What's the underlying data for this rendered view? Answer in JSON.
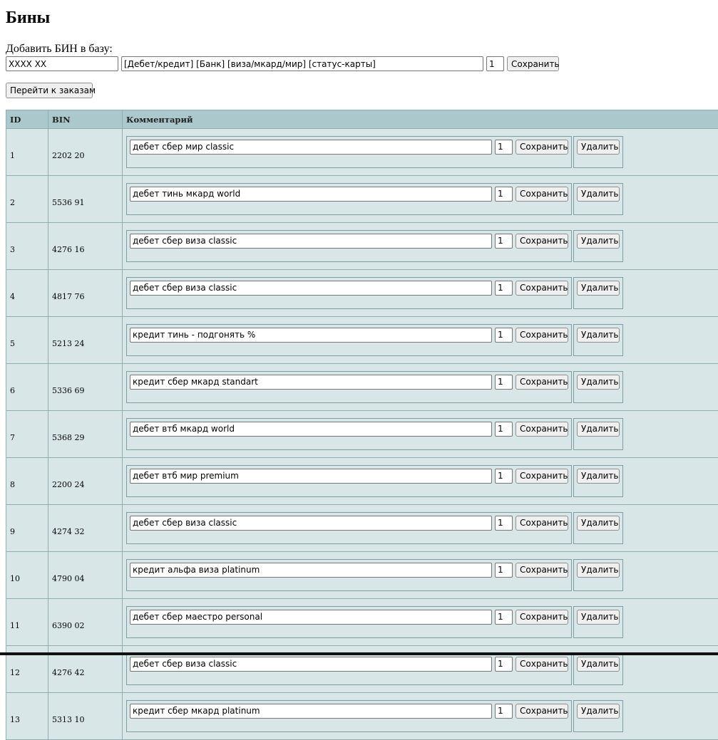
{
  "page": {
    "title": "Бины",
    "add_label": "Добавить БИН в базу:",
    "add_bin_value": "XXXX XX",
    "add_comment_value": "[Дебет/кредит] [Банк] [виза/мкард/мир] [статус-карты]",
    "add_qty_value": "1",
    "save_label": "Сохранить",
    "go_orders_label": "Перейти к заказам"
  },
  "table": {
    "headers": {
      "id": "ID",
      "bin": "BIN",
      "comment": "Комментарий"
    },
    "save_label": "Сохранить",
    "delete_label": "Удалить",
    "rows": [
      {
        "id": "1",
        "bin": "2202 20",
        "comment": "дебет сбер мир classic",
        "qty": "1"
      },
      {
        "id": "2",
        "bin": "5536 91",
        "comment": "дебет тинь мкард world",
        "qty": "1"
      },
      {
        "id": "3",
        "bin": "4276 16",
        "comment": "дебет сбер виза classic",
        "qty": "1"
      },
      {
        "id": "4",
        "bin": "4817 76",
        "comment": "дебет сбер виза classic",
        "qty": "1"
      },
      {
        "id": "5",
        "bin": "5213 24",
        "comment": "кредит тинь - подгонять %",
        "qty": "1"
      },
      {
        "id": "6",
        "bin": "5336 69",
        "comment": "кредит сбер мкард standart",
        "qty": "1"
      },
      {
        "id": "7",
        "bin": "5368 29",
        "comment": "дебет втб мкард world",
        "qty": "1"
      },
      {
        "id": "8",
        "bin": "2200 24",
        "comment": "дебет втб мир premium",
        "qty": "1"
      },
      {
        "id": "9",
        "bin": "4274 32",
        "comment": "дебет сбер виза classic",
        "qty": "1"
      },
      {
        "id": "10",
        "bin": "4790 04",
        "comment": "кредит альфа виза platinum",
        "qty": "1"
      },
      {
        "id": "11",
        "bin": "6390 02",
        "comment": "дебет сбер маестро personal",
        "qty": "1"
      },
      {
        "id": "12",
        "bin": "4276 42",
        "comment": "дебет сбер виза classic",
        "qty": "1"
      },
      {
        "id": "13",
        "bin": "5313 10",
        "comment": "кредит сбер мкард platinum",
        "qty": "1"
      }
    ]
  }
}
